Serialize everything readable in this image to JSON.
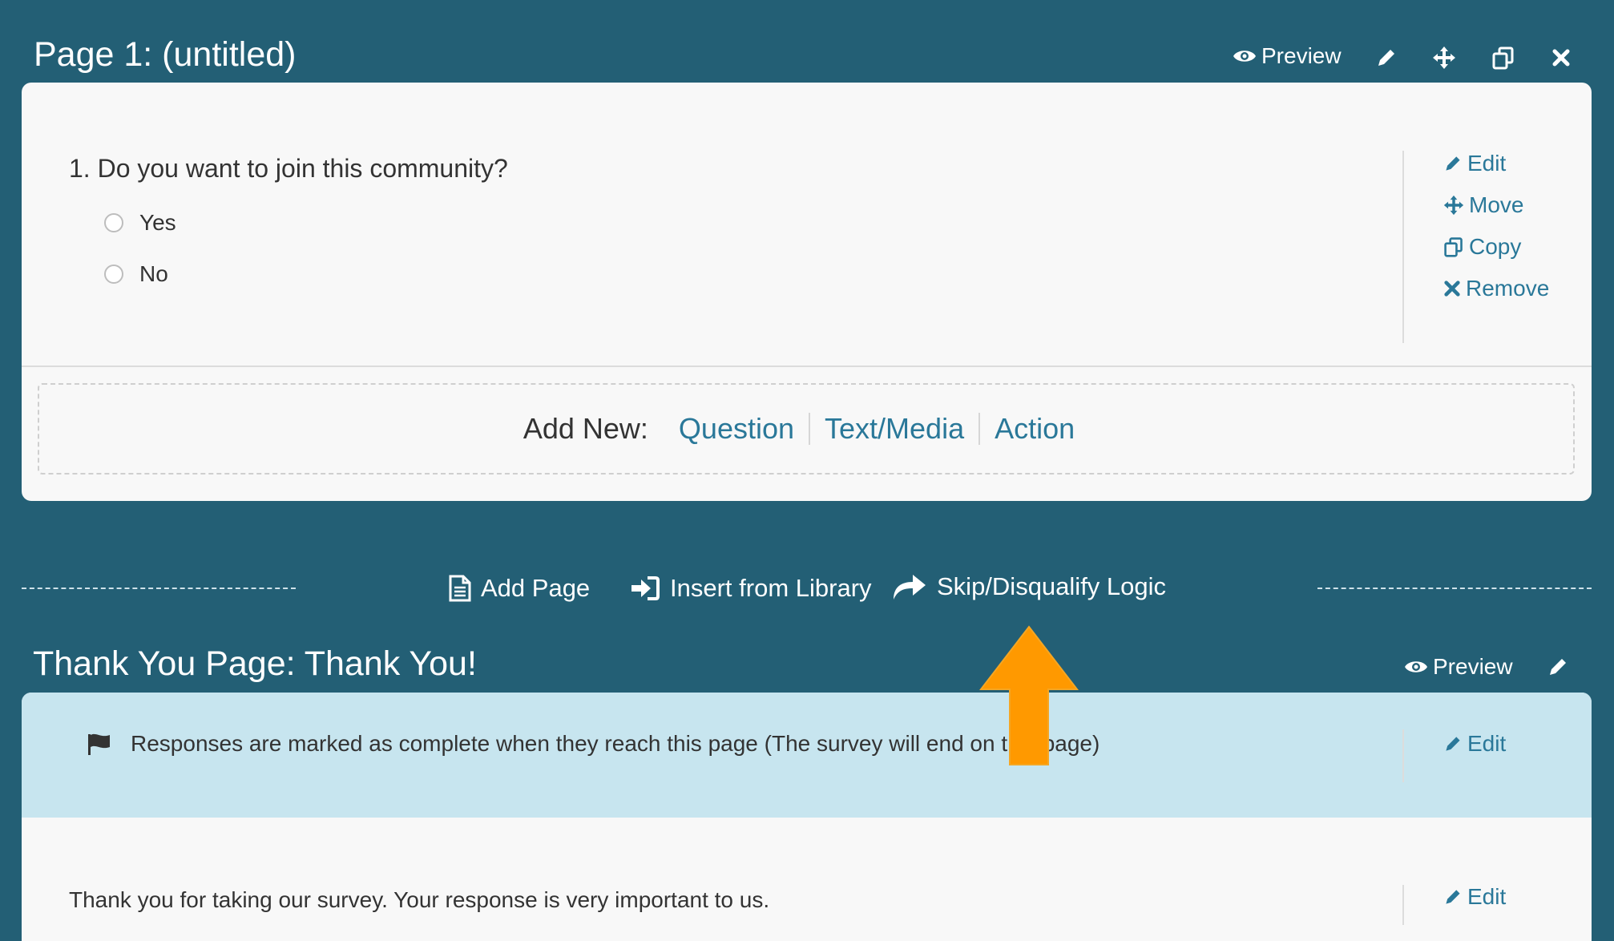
{
  "page1": {
    "title": "Page 1: (untitled)",
    "preview_label": "Preview",
    "header_icons": [
      "eye-icon",
      "pencil-icon",
      "move-icon",
      "copy-icon",
      "close-icon"
    ]
  },
  "question": {
    "title": "1. Do you want to join this community?",
    "options": [
      "Yes",
      "No"
    ],
    "actions": {
      "edit": "Edit",
      "move": "Move",
      "copy": "Copy",
      "remove": "Remove"
    }
  },
  "add_new": {
    "label": "Add New:",
    "question": "Question",
    "text_media": "Text/Media",
    "action": "Action"
  },
  "toolbar": {
    "add_page": "Add Page",
    "insert_library": "Insert from Library",
    "skip_logic": "Skip/Disqualify Logic"
  },
  "thank_you": {
    "title": "Thank You Page: Thank You!",
    "preview_label": "Preview",
    "info_text": "Responses are marked as complete when they reach this page (The survey will end on this page)",
    "info_edit": "Edit",
    "message": "Thank you for taking our survey. Your response is very important to us.",
    "message_edit": "Edit"
  },
  "colors": {
    "background": "#235f75",
    "panel": "#f8f8f8",
    "link": "#2a7899",
    "info_band": "#c7e5ef",
    "arrow": "#ff9900"
  }
}
